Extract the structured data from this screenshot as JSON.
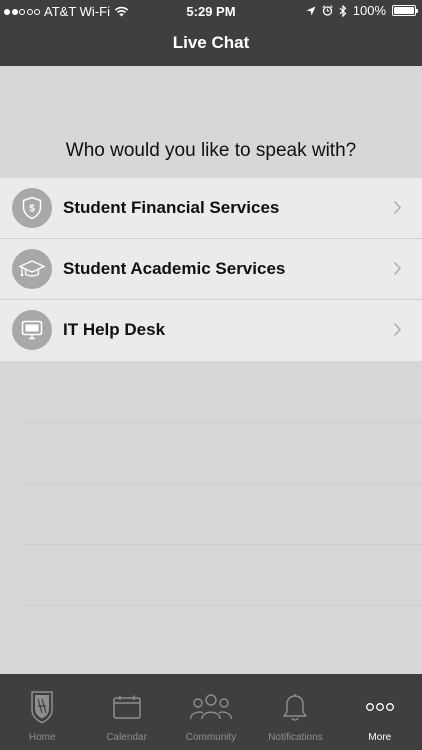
{
  "status_bar": {
    "carrier": "AT&T Wi-Fi",
    "time": "5:29 PM",
    "battery": "100%"
  },
  "header": {
    "title": "Live Chat"
  },
  "prompt": "Who would you like to speak with?",
  "options": [
    {
      "label": "Student Financial Services",
      "icon": "shield-dollar-icon"
    },
    {
      "label": "Student Academic Services",
      "icon": "graduation-cap-icon"
    },
    {
      "label": "IT Help Desk",
      "icon": "monitor-icon"
    }
  ],
  "tabs": [
    {
      "label": "Home",
      "icon": "shield-crest-icon"
    },
    {
      "label": "Calendar",
      "icon": "calendar-icon"
    },
    {
      "label": "Community",
      "icon": "people-icon"
    },
    {
      "label": "Notifications",
      "icon": "bell-icon"
    },
    {
      "label": "More",
      "icon": "more-dots-icon"
    }
  ],
  "colors": {
    "nav_bar": "#3f3f3f",
    "background": "#d7d7d7",
    "list_row": "#ebebeb",
    "icon_badge": "#a8a8a8",
    "tab_inactive": "#8e8e8e",
    "tab_active": "#ffffff"
  }
}
